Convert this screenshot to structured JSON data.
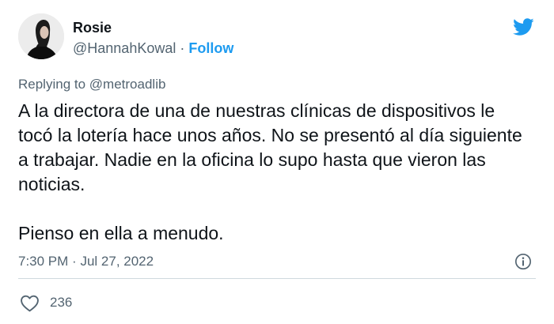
{
  "author": {
    "name": "Rosie",
    "handle": "@HannahKowal",
    "separator": "·",
    "follow_label": "Follow"
  },
  "reply": {
    "prefix": "Replying to",
    "mention": "@metroadlib"
  },
  "tweet": {
    "paragraph1": "A la directora de una de nuestras clínicas de dispositivos le tocó la lotería hace unos años. No se presentó al día siguiente a trabajar. Nadie en la oficina lo supo hasta que vieron las noticias.",
    "paragraph2": "Pienso en ella a menudo."
  },
  "meta": {
    "time": "7:30 PM",
    "separator": "·",
    "date": "Jul 27, 2022"
  },
  "actions": {
    "like_count": "236"
  },
  "icons": {
    "brand": "twitter-bird-icon",
    "info": "info-icon",
    "like": "heart-icon"
  },
  "colors": {
    "accent": "#1d9bf0",
    "text": "#0f1419",
    "secondary": "#536471",
    "divider": "#cfd9de"
  }
}
